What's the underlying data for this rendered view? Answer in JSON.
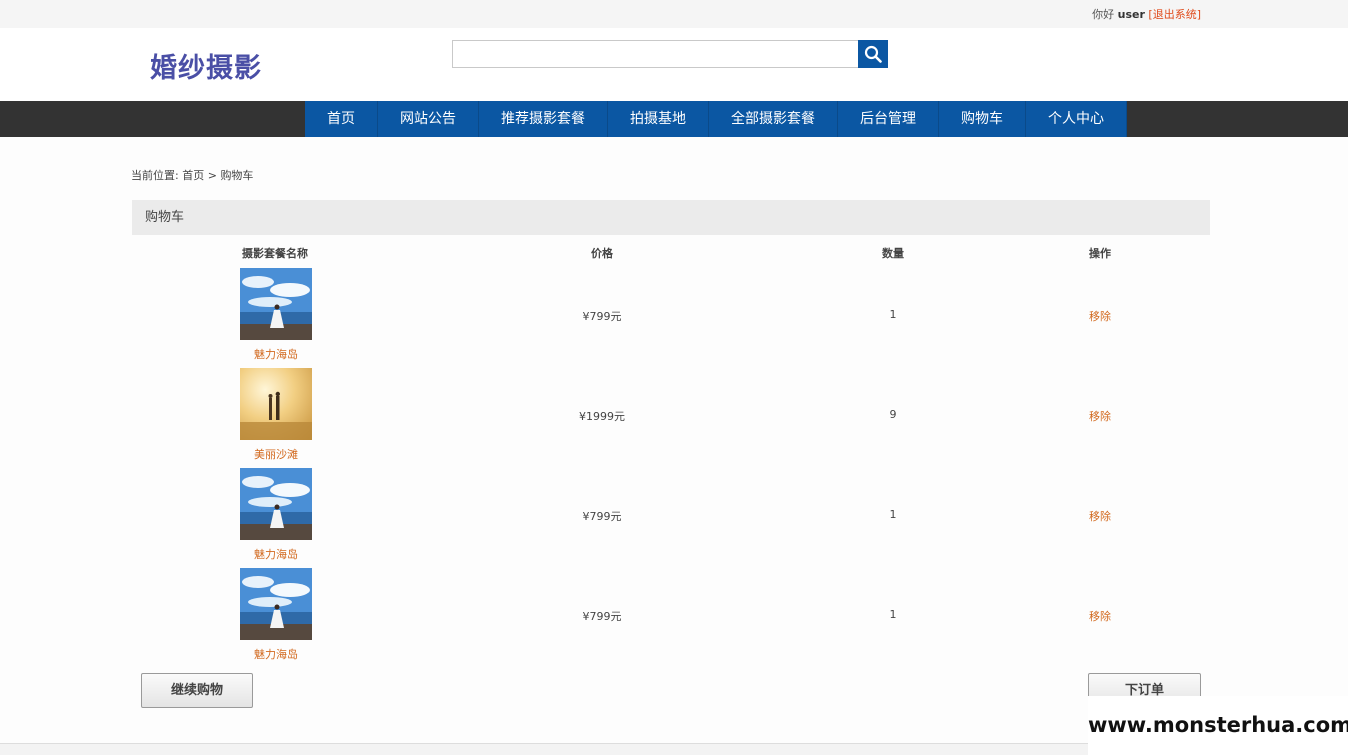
{
  "topbar": {
    "greeting": "你好",
    "username": "user",
    "logout": "[退出系统]"
  },
  "header": {
    "logo": "婚纱摄影",
    "search_placeholder": "",
    "search_value": ""
  },
  "nav": [
    {
      "label": "首页"
    },
    {
      "label": "网站公告"
    },
    {
      "label": "推荐摄影套餐"
    },
    {
      "label": "拍摄基地"
    },
    {
      "label": "全部摄影套餐"
    },
    {
      "label": "后台管理"
    },
    {
      "label": "购物车"
    },
    {
      "label": "个人中心"
    }
  ],
  "breadcrumb": {
    "prefix": "当前位置:",
    "home": "首页",
    "separator": ">",
    "current": "购物车"
  },
  "panel": {
    "title": "购物车"
  },
  "table": {
    "headers": {
      "name": "摄影套餐名称",
      "price": "价格",
      "qty": "数量",
      "action": "操作"
    },
    "rows": [
      {
        "name": "魅力海岛",
        "price": "¥799元",
        "qty": "1",
        "action": "移除",
        "image": "island-photo"
      },
      {
        "name": "美丽沙滩",
        "price": "¥1999元",
        "qty": "9",
        "action": "移除",
        "image": "beach-photo"
      },
      {
        "name": "魅力海岛",
        "price": "¥799元",
        "qty": "1",
        "action": "移除",
        "image": "island-photo"
      },
      {
        "name": "魅力海岛",
        "price": "¥799元",
        "qty": "1",
        "action": "移除",
        "image": "island-photo"
      }
    ]
  },
  "buttons": {
    "continue": "继续购物",
    "order": "下订单"
  },
  "watermark": "www.monsterhua.com",
  "colors": {
    "nav_blue": "#0b57a3",
    "nav_bar": "#333333",
    "link_orange": "#d2691e",
    "logo": "#4a4fa6",
    "logout_red": "#e04a1a"
  },
  "icons": {
    "search": "search-icon"
  }
}
